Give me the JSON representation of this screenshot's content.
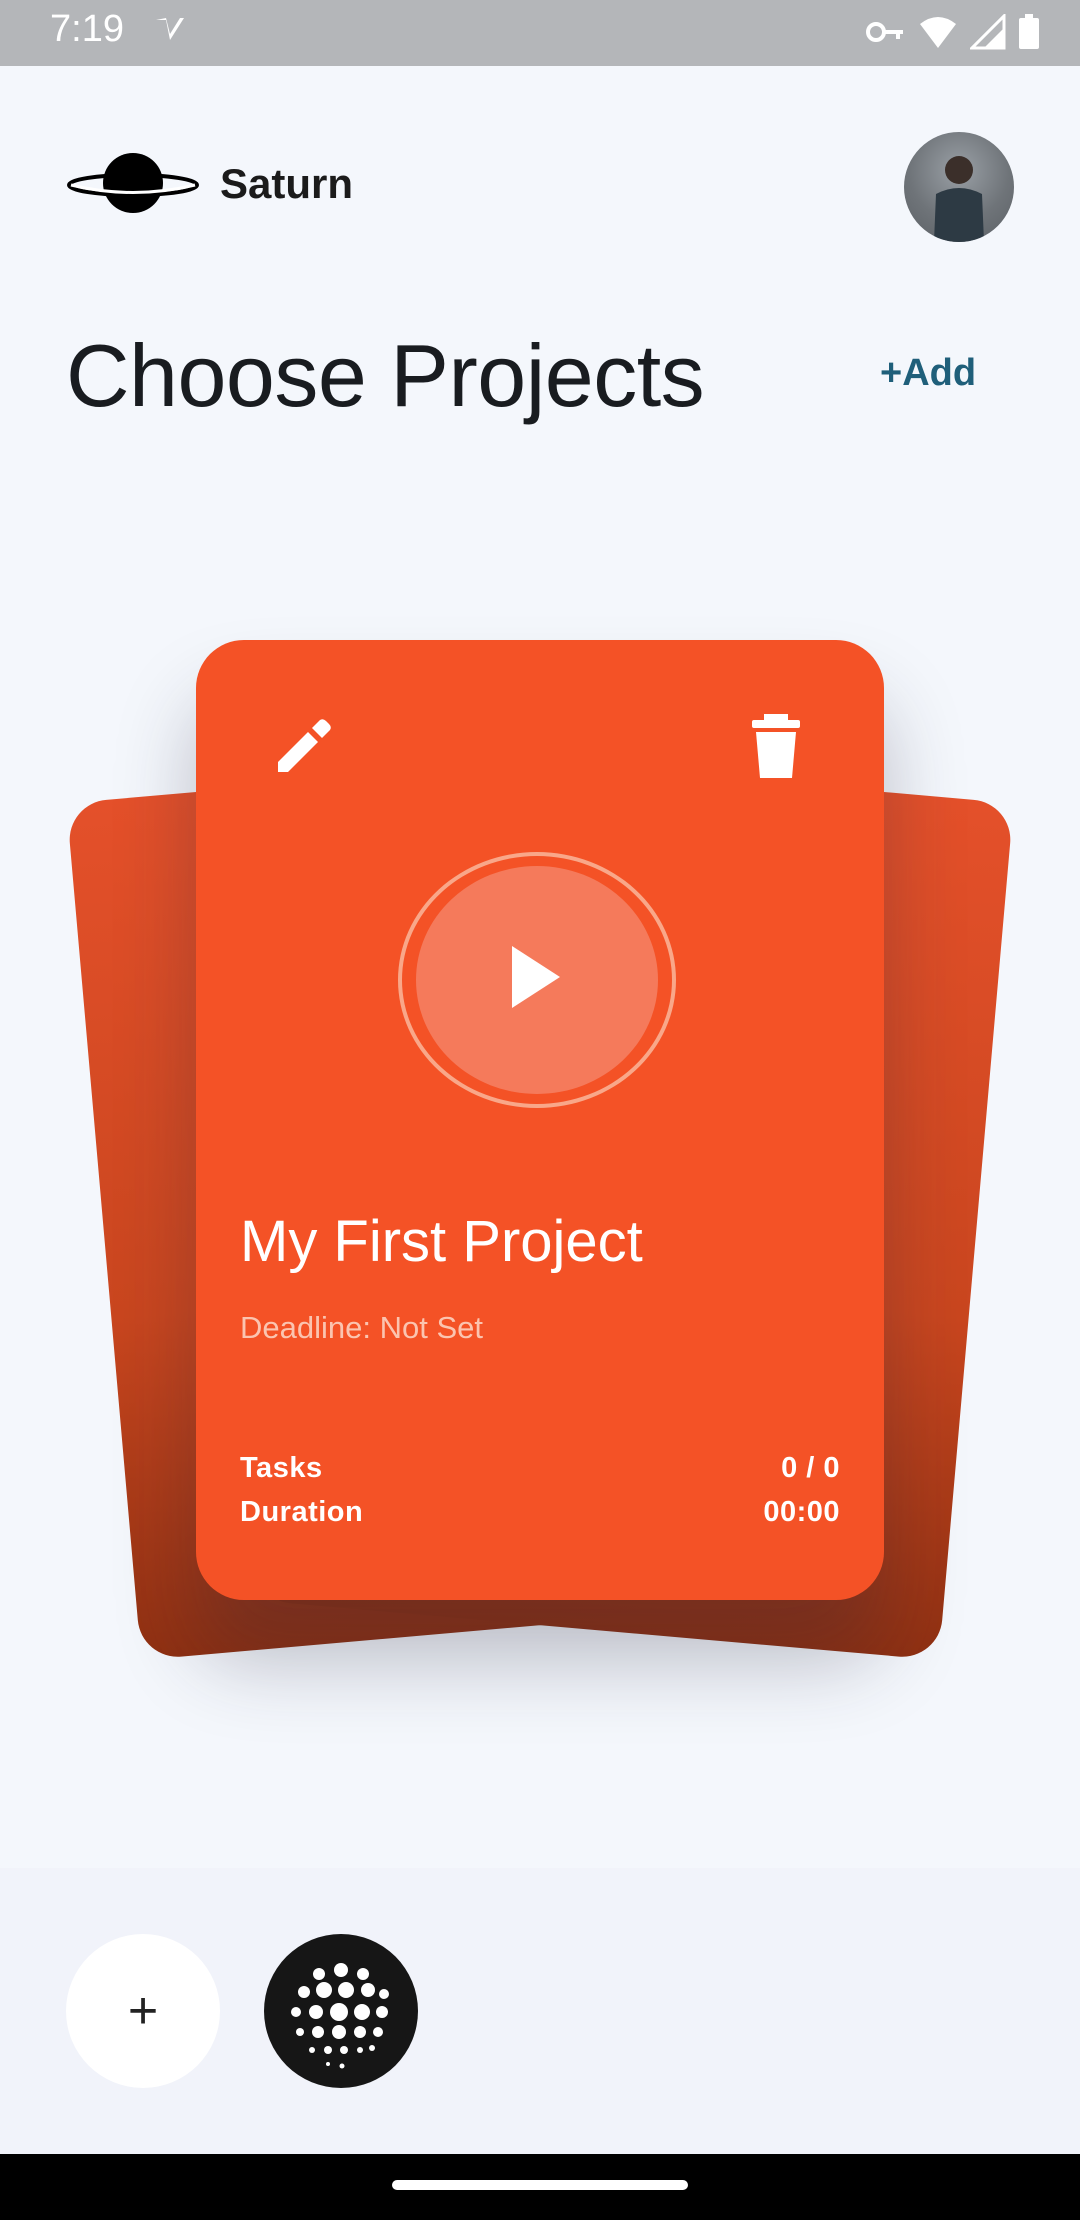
{
  "status_bar": {
    "time": "7:19",
    "icons": [
      "notification-check-icon",
      "vpn-key-icon",
      "wifi-icon",
      "signal-icon",
      "battery-icon"
    ]
  },
  "header": {
    "app_name": "Saturn",
    "logo_icon": "saturn-planet-icon",
    "avatar": "user-avatar"
  },
  "page": {
    "title": "Choose Projects",
    "add_label": "+Add"
  },
  "project_card": {
    "title": "My First Project",
    "deadline": "Deadline: Not Set",
    "stats": [
      {
        "label": "Tasks",
        "value": "0 / 0"
      },
      {
        "label": "Duration",
        "value": "00:00"
      }
    ],
    "icons": [
      "edit-icon",
      "delete-icon",
      "play-icon"
    ],
    "color": "#f45226"
  },
  "fabs": {
    "add_symbol": "+",
    "second_icon": "dot-grid-icon"
  },
  "colors": {
    "background": "#f4f7fc",
    "accent_link": "#1f5f7a",
    "card": "#f45226"
  }
}
